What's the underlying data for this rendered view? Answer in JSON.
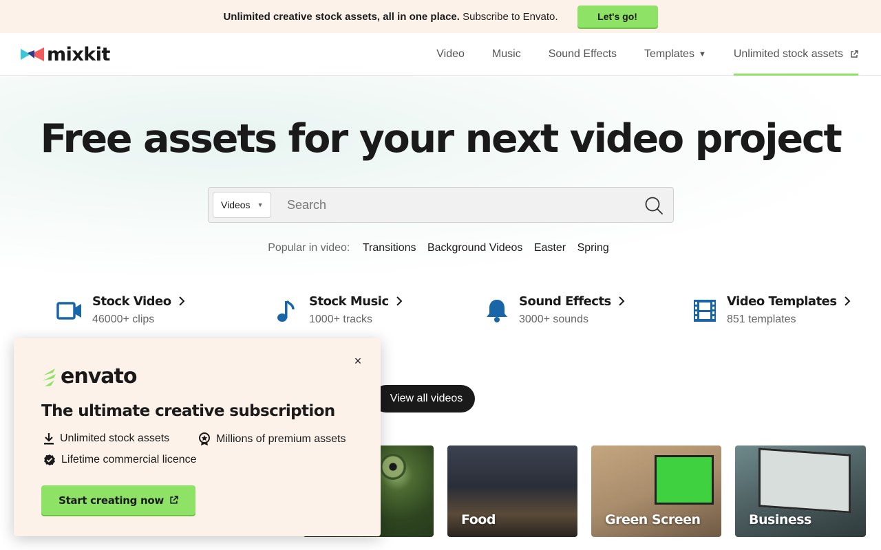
{
  "banner": {
    "message_bold": "Unlimited creative stock assets, all in one place.",
    "message_rest": "Subscribe to Envato.",
    "cta_label": "Let's go!"
  },
  "header": {
    "logo_text": "mixkit",
    "nav": [
      {
        "label": "Video"
      },
      {
        "label": "Music"
      },
      {
        "label": "Sound Effects"
      },
      {
        "label": "Templates"
      },
      {
        "label": "Unlimited stock assets"
      }
    ]
  },
  "hero": {
    "title": "Free assets for your next video project"
  },
  "search": {
    "selected_type": "Videos",
    "placeholder": "Search",
    "value": ""
  },
  "popular": {
    "label": "Popular in video:",
    "tags": [
      "Transitions",
      "Background Videos",
      "Easter",
      "Spring"
    ]
  },
  "categories": [
    {
      "title": "Stock Video",
      "subtitle": "46000+ clips",
      "icon": "video-camera-icon"
    },
    {
      "title": "Stock Music",
      "subtitle": "1000+ tracks",
      "icon": "music-note-icon"
    },
    {
      "title": "Sound Effects",
      "subtitle": "3000+ sounds",
      "icon": "bell-icon"
    },
    {
      "title": "Video Templates",
      "subtitle": "851 templates",
      "icon": "film-strip-icon"
    }
  ],
  "view_all_label": "View all videos",
  "thumbnails": [
    {
      "label": ""
    },
    {
      "label": "Food"
    },
    {
      "label": "Green Screen"
    },
    {
      "label": "Business"
    }
  ],
  "modal": {
    "brand": "envato",
    "title": "The ultimate creative subscription",
    "features": [
      "Unlimited stock assets",
      "Millions of premium assets",
      "Lifetime commercial licence"
    ],
    "cta_label": "Start creating now",
    "close_symbol": "×"
  },
  "colors": {
    "accent_green": "#8ee265",
    "icon_blue": "#1866a8",
    "banner_bg": "#fdf2e9"
  }
}
